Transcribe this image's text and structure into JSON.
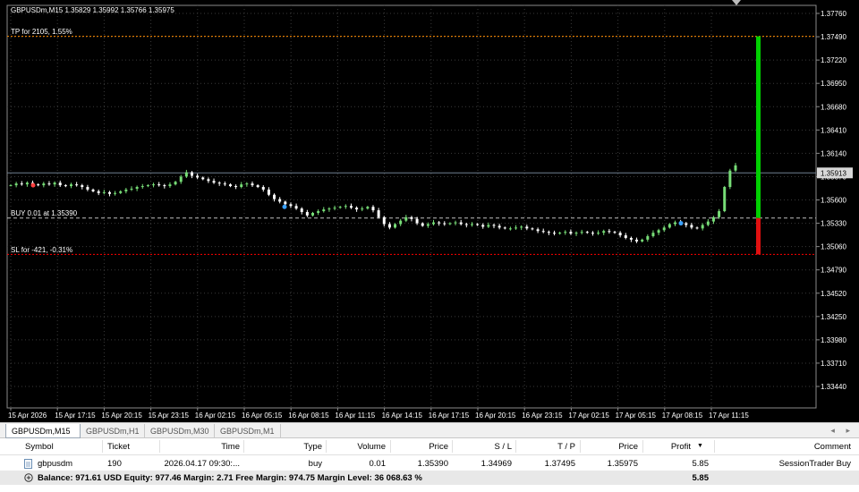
{
  "chart": {
    "info": "GBPUSDm,M15  1.35829 1.35992 1.35766 1.35975",
    "tp_label": "TP for 2105, 1.55%",
    "buy_label": "BUY 0.01 at 1.35390",
    "sl_label": "SL for -421, -0.31%",
    "current_price_label": "1.35913",
    "price_ticks": [
      "1.37760",
      "1.37490",
      "1.37220",
      "1.36950",
      "1.36680",
      "1.36410",
      "1.36140",
      "1.35870",
      "1.35600",
      "1.35330",
      "1.35060",
      "1.34790",
      "1.34520",
      "1.34250",
      "1.33980",
      "1.33710",
      "1.33440"
    ],
    "time_ticks": [
      "15 Apr 2026",
      "15 Apr 17:15",
      "15 Apr 20:15",
      "15 Apr 23:15",
      "16 Apr 02:15",
      "16 Apr 05:15",
      "16 Apr 08:15",
      "16 Apr 11:15",
      "16 Apr 14:15",
      "16 Apr 17:15",
      "16 Apr 20:15",
      "16 Apr 23:15",
      "17 Apr 02:15",
      "17 Apr 05:15",
      "17 Apr 08:15",
      "17 Apr 11:15"
    ],
    "colors": {
      "background": "#000000",
      "grid": "#3a3a3a",
      "bar_up": "#77dd77",
      "bar_down": "#ffffff",
      "tp_line": "#ff8c00",
      "sl_line": "#ff0000",
      "buy_line": "#c0c0c0",
      "tp_bar": "#00d000",
      "sl_bar": "#e01010"
    },
    "candles_close": [
      1.3577,
      1.3579,
      1.3578,
      1.358,
      1.3578,
      1.3577,
      1.3579,
      1.3578,
      1.358,
      1.3577,
      1.3576,
      1.3578,
      1.3577,
      1.3575,
      1.3572,
      1.357,
      1.3568,
      1.3569,
      1.3567,
      1.3568,
      1.357,
      1.3572,
      1.3573,
      1.3575,
      1.3576,
      1.3577,
      1.3578,
      1.3577,
      1.3576,
      1.3578,
      1.3581,
      1.3587,
      1.3592,
      1.3588,
      1.3586,
      1.3584,
      1.3582,
      1.358,
      1.3579,
      1.3578,
      1.3576,
      1.3575,
      1.3578,
      1.3579,
      1.3577,
      1.3575,
      1.3572,
      1.3566,
      1.3561,
      1.3558,
      1.3555,
      1.3553,
      1.355,
      1.3546,
      1.3542,
      1.3545,
      1.3547,
      1.3549,
      1.355,
      1.3551,
      1.3552,
      1.3553,
      1.3551,
      1.3549,
      1.355,
      1.3552,
      1.3548,
      1.354,
      1.3532,
      1.3528,
      1.3532,
      1.3536,
      1.354,
      1.3538,
      1.3533,
      1.353,
      1.3532,
      1.3534,
      1.3533,
      1.3532,
      1.3533,
      1.3534,
      1.3532,
      1.3531,
      1.3532,
      1.3531,
      1.3529,
      1.3531,
      1.353,
      1.3528,
      1.3527,
      1.3527,
      1.3528,
      1.3529,
      1.3527,
      1.3526,
      1.3524,
      1.3523,
      1.3522,
      1.3521,
      1.3522,
      1.3523,
      1.3521,
      1.3522,
      1.3523,
      1.3522,
      1.3521,
      1.3522,
      1.3524,
      1.3523,
      1.3522,
      1.3519,
      1.3516,
      1.3514,
      1.3512,
      1.3514,
      1.3518,
      1.3522,
      1.3525,
      1.3528,
      1.3532,
      1.3534,
      1.3533,
      1.3531,
      1.3528,
      1.3527,
      1.3531,
      1.3535,
      1.354,
      1.3547,
      1.3575,
      1.3594,
      1.36
    ]
  },
  "tabs": [
    {
      "label": "GBPUSDm,M15",
      "active": true
    },
    {
      "label": "GBPUSDm,H1",
      "active": false
    },
    {
      "label": "GBPUSDm,M30",
      "active": false
    },
    {
      "label": "GBPUSDm,M1",
      "active": false
    }
  ],
  "tab_nav": {
    "prev": "◂",
    "next": "▸"
  },
  "trade": {
    "headers": {
      "symbol": "Symbol",
      "ticket": "Ticket",
      "time": "Time",
      "type": "Type",
      "volume": "Volume",
      "price": "Price",
      "sl": "S / L",
      "tp": "T / P",
      "cur_price": "Price",
      "profit": "Profit",
      "sort_indicator": "▼",
      "comment": "Comment"
    },
    "row": {
      "symbol": "gbpusdm",
      "ticket": "190",
      "time": "2026.04.17 09:30:...",
      "type": "buy",
      "volume": "0.01",
      "price": "1.35390",
      "sl": "1.34969",
      "tp": "1.37495",
      "cur_price": "1.35975",
      "profit": "5.85",
      "comment": "SessionTrader Buy"
    },
    "balance": {
      "text": "Balance: 971.61 USD  Equity: 977.46  Margin: 2.71  Free Margin: 974.75  Margin Level: 36 068.63 %",
      "profit": "5.85"
    }
  }
}
